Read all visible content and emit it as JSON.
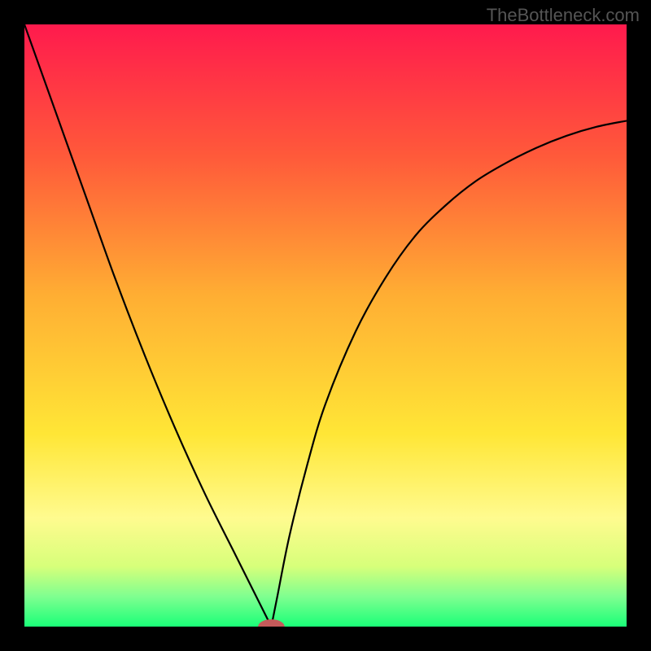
{
  "watermark": "TheBottleneck.com",
  "chart_data": {
    "type": "line",
    "title": "",
    "xlabel": "",
    "ylabel": "",
    "xlim": [
      0,
      100
    ],
    "ylim": [
      0,
      100
    ],
    "background_gradient": {
      "stops": [
        {
          "pos": 0.0,
          "color": "#ff1a4d"
        },
        {
          "pos": 0.22,
          "color": "#ff5a3a"
        },
        {
          "pos": 0.45,
          "color": "#ffae33"
        },
        {
          "pos": 0.68,
          "color": "#ffe636"
        },
        {
          "pos": 0.82,
          "color": "#fffb8f"
        },
        {
          "pos": 0.9,
          "color": "#d7ff7a"
        },
        {
          "pos": 0.95,
          "color": "#7fff90"
        },
        {
          "pos": 1.0,
          "color": "#1aff78"
        }
      ]
    },
    "series": [
      {
        "name": "bottleneck-curve",
        "side": "left",
        "x": [
          0,
          5,
          10,
          15,
          20,
          25,
          30,
          35,
          38,
          40,
          41
        ],
        "y": [
          100,
          86,
          72,
          58,
          45,
          33,
          22,
          12,
          6,
          2,
          0
        ]
      },
      {
        "name": "bottleneck-curve",
        "side": "right",
        "x": [
          41,
          42,
          44,
          47,
          50,
          55,
          60,
          65,
          70,
          75,
          80,
          85,
          90,
          95,
          100
        ],
        "y": [
          0,
          5,
          15,
          27,
          37,
          49,
          58,
          65,
          70,
          74,
          77,
          79.5,
          81.5,
          83,
          84
        ]
      }
    ],
    "marker": {
      "name": "optimal-marker",
      "x": 41,
      "y": 0,
      "rx": 2.2,
      "ry": 1.2,
      "color": "#c55a5a"
    }
  }
}
